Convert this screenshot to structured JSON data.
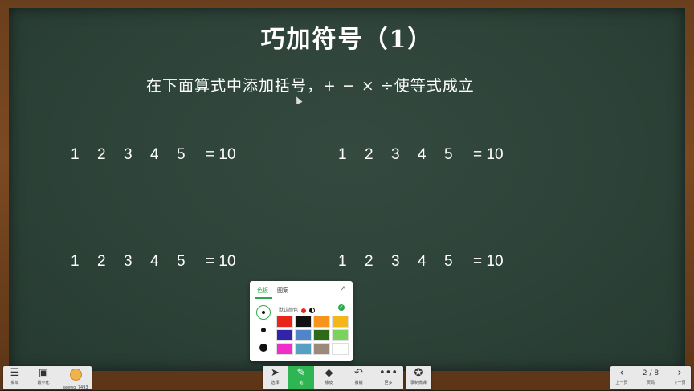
{
  "slide": {
    "title": "巧加符号（1）",
    "instruction": "在下面算式中添加括号，+ − × ÷使等式成立",
    "equations": [
      {
        "numbers": [
          "1",
          "2",
          "3",
          "4",
          "5"
        ],
        "result": "= 10"
      },
      {
        "numbers": [
          "1",
          "2",
          "3",
          "4",
          "5"
        ],
        "result": "= 10"
      },
      {
        "numbers": [
          "1",
          "2",
          "3",
          "4",
          "5"
        ],
        "result": "= 10"
      },
      {
        "numbers": [
          "1",
          "2",
          "3",
          "4",
          "5"
        ],
        "result": "= 10"
      }
    ]
  },
  "color_panel": {
    "tabs": [
      {
        "label": "色板",
        "active": true
      },
      {
        "label": "图案",
        "active": false
      }
    ],
    "default_label": "默认颜色",
    "pen_sizes": [
      "small",
      "medium",
      "large"
    ],
    "selected_size": "small",
    "swatches": [
      "#e8251b",
      "#111111",
      "#f7941d",
      "#f4b71b",
      "#3224a8",
      "#4f86c9",
      "#2e6b18",
      "#7ad35a",
      "#f02fc9",
      "#56a0c4",
      "#9b8a7a",
      "#ffffff"
    ]
  },
  "toolbar_left": [
    {
      "label": "菜单",
      "icon": "menu-icon"
    },
    {
      "label": "最小化",
      "icon": "minimize-icon"
    },
    {
      "label": "seewo_7493",
      "icon": "avatar"
    }
  ],
  "toolbar_center": [
    {
      "label": "选择",
      "icon": "cursor-icon",
      "glyph": "➤",
      "active": false
    },
    {
      "label": "笔",
      "icon": "pen-icon",
      "glyph": "✎",
      "active": true
    },
    {
      "label": "橡皮",
      "icon": "eraser-icon",
      "glyph": "◆",
      "active": false
    },
    {
      "label": "撤销",
      "icon": "undo-icon",
      "glyph": "↶",
      "active": false
    },
    {
      "label": "更多",
      "icon": "more-icon",
      "glyph": "•••",
      "active": false
    }
  ],
  "toolbar_record": {
    "label": "录制微课",
    "icon": "record-icon",
    "glyph": "✪"
  },
  "toolbar_right": {
    "prev_label": "上一页",
    "page_label": "页码",
    "page_indicator": "2 / 8",
    "next_label": "下一页"
  }
}
